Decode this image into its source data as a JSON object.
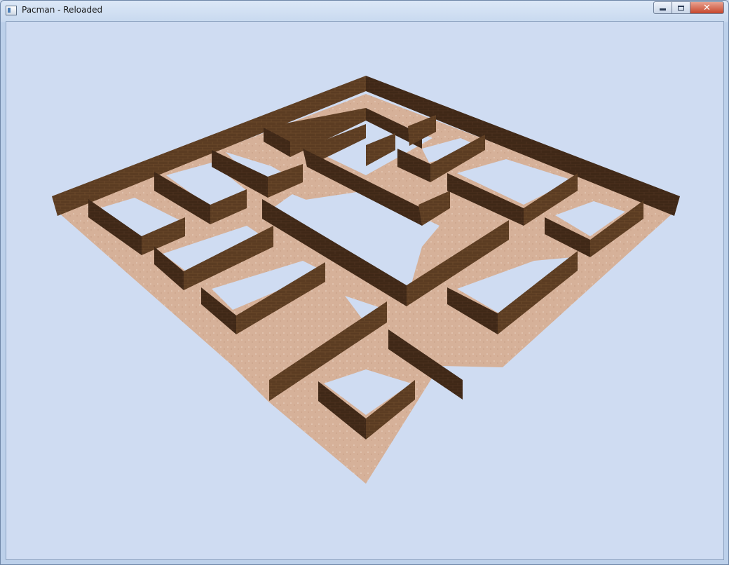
{
  "window": {
    "title": "Pacman - Reloaded",
    "controls": [
      "minimize",
      "maximize",
      "close"
    ]
  },
  "scene": {
    "floor_color": "#d9b49a",
    "wall_color": "#5a3c24",
    "wall_side_color": "#3d2616",
    "background_color": "#cfdcf2"
  }
}
